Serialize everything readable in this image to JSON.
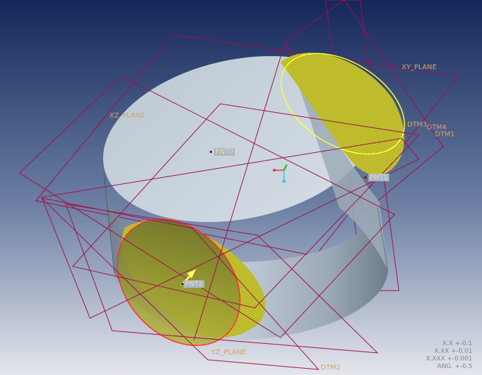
{
  "viewport": {
    "background_top": "#14275a",
    "background_bottom": "#e4e6ec"
  },
  "datum_planes": [
    {
      "name": "XY_PLANE",
      "label": "XY_PLANE"
    },
    {
      "name": "XZ_PLANE",
      "label": "XZ_PLANE"
    },
    {
      "name": "YZ_PLANE",
      "label": "YZ_PLANE"
    },
    {
      "name": "DTM1",
      "label": "DTM1"
    },
    {
      "name": "DTM2",
      "label": "DTM2"
    },
    {
      "name": "DTM3",
      "label": "DTM3"
    },
    {
      "name": "DTM4",
      "label": "DTM4"
    }
  ],
  "datum_points": [
    {
      "name": "PNT0",
      "label": "PNT0"
    },
    {
      "name": "PNT1",
      "label": "PNT1"
    },
    {
      "name": "PNT2",
      "label": "PNT2"
    }
  ],
  "tolerances": [
    "X.X +-0.1",
    "X.XX +-0.01",
    "X.XXX +-0.001",
    "ANG. +-0.5"
  ],
  "colors": {
    "datum_plane": "#a0104a",
    "datum_label": "#d8a060",
    "solid_body": "#b4c2cf",
    "cut_surface": "#b8b828",
    "selected_edge_yellow": "#ffff30",
    "selected_edge_red": "#ff3030"
  },
  "icons": [
    "coordinate-system-icon",
    "direction-arrow-icon"
  ]
}
